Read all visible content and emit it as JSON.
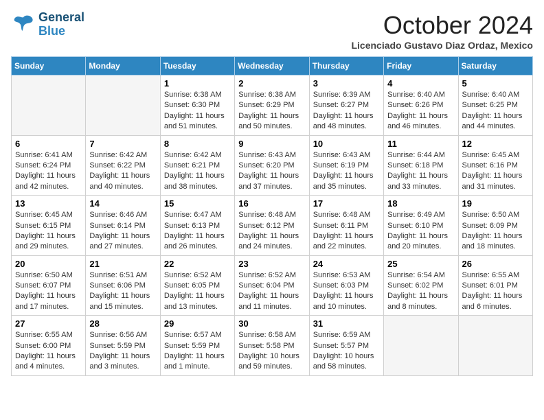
{
  "header": {
    "logo_line1": "General",
    "logo_line2": "Blue",
    "title": "October 2024",
    "location": "Licenciado Gustavo Diaz Ordaz, Mexico"
  },
  "weekdays": [
    "Sunday",
    "Monday",
    "Tuesday",
    "Wednesday",
    "Thursday",
    "Friday",
    "Saturday"
  ],
  "weeks": [
    [
      {
        "day": "",
        "empty": true
      },
      {
        "day": "",
        "empty": true
      },
      {
        "day": "1",
        "sunrise": "6:38 AM",
        "sunset": "6:30 PM",
        "daylight": "11 hours and 51 minutes."
      },
      {
        "day": "2",
        "sunrise": "6:38 AM",
        "sunset": "6:29 PM",
        "daylight": "11 hours and 50 minutes."
      },
      {
        "day": "3",
        "sunrise": "6:39 AM",
        "sunset": "6:27 PM",
        "daylight": "11 hours and 48 minutes."
      },
      {
        "day": "4",
        "sunrise": "6:40 AM",
        "sunset": "6:26 PM",
        "daylight": "11 hours and 46 minutes."
      },
      {
        "day": "5",
        "sunrise": "6:40 AM",
        "sunset": "6:25 PM",
        "daylight": "11 hours and 44 minutes."
      }
    ],
    [
      {
        "day": "6",
        "sunrise": "6:41 AM",
        "sunset": "6:24 PM",
        "daylight": "11 hours and 42 minutes."
      },
      {
        "day": "7",
        "sunrise": "6:42 AM",
        "sunset": "6:22 PM",
        "daylight": "11 hours and 40 minutes."
      },
      {
        "day": "8",
        "sunrise": "6:42 AM",
        "sunset": "6:21 PM",
        "daylight": "11 hours and 38 minutes."
      },
      {
        "day": "9",
        "sunrise": "6:43 AM",
        "sunset": "6:20 PM",
        "daylight": "11 hours and 37 minutes."
      },
      {
        "day": "10",
        "sunrise": "6:43 AM",
        "sunset": "6:19 PM",
        "daylight": "11 hours and 35 minutes."
      },
      {
        "day": "11",
        "sunrise": "6:44 AM",
        "sunset": "6:18 PM",
        "daylight": "11 hours and 33 minutes."
      },
      {
        "day": "12",
        "sunrise": "6:45 AM",
        "sunset": "6:16 PM",
        "daylight": "11 hours and 31 minutes."
      }
    ],
    [
      {
        "day": "13",
        "sunrise": "6:45 AM",
        "sunset": "6:15 PM",
        "daylight": "11 hours and 29 minutes."
      },
      {
        "day": "14",
        "sunrise": "6:46 AM",
        "sunset": "6:14 PM",
        "daylight": "11 hours and 27 minutes."
      },
      {
        "day": "15",
        "sunrise": "6:47 AM",
        "sunset": "6:13 PM",
        "daylight": "11 hours and 26 minutes."
      },
      {
        "day": "16",
        "sunrise": "6:48 AM",
        "sunset": "6:12 PM",
        "daylight": "11 hours and 24 minutes."
      },
      {
        "day": "17",
        "sunrise": "6:48 AM",
        "sunset": "6:11 PM",
        "daylight": "11 hours and 22 minutes."
      },
      {
        "day": "18",
        "sunrise": "6:49 AM",
        "sunset": "6:10 PM",
        "daylight": "11 hours and 20 minutes."
      },
      {
        "day": "19",
        "sunrise": "6:50 AM",
        "sunset": "6:09 PM",
        "daylight": "11 hours and 18 minutes."
      }
    ],
    [
      {
        "day": "20",
        "sunrise": "6:50 AM",
        "sunset": "6:07 PM",
        "daylight": "11 hours and 17 minutes."
      },
      {
        "day": "21",
        "sunrise": "6:51 AM",
        "sunset": "6:06 PM",
        "daylight": "11 hours and 15 minutes."
      },
      {
        "day": "22",
        "sunrise": "6:52 AM",
        "sunset": "6:05 PM",
        "daylight": "11 hours and 13 minutes."
      },
      {
        "day": "23",
        "sunrise": "6:52 AM",
        "sunset": "6:04 PM",
        "daylight": "11 hours and 11 minutes."
      },
      {
        "day": "24",
        "sunrise": "6:53 AM",
        "sunset": "6:03 PM",
        "daylight": "11 hours and 10 minutes."
      },
      {
        "day": "25",
        "sunrise": "6:54 AM",
        "sunset": "6:02 PM",
        "daylight": "11 hours and 8 minutes."
      },
      {
        "day": "26",
        "sunrise": "6:55 AM",
        "sunset": "6:01 PM",
        "daylight": "11 hours and 6 minutes."
      }
    ],
    [
      {
        "day": "27",
        "sunrise": "6:55 AM",
        "sunset": "6:00 PM",
        "daylight": "11 hours and 4 minutes."
      },
      {
        "day": "28",
        "sunrise": "6:56 AM",
        "sunset": "5:59 PM",
        "daylight": "11 hours and 3 minutes."
      },
      {
        "day": "29",
        "sunrise": "6:57 AM",
        "sunset": "5:59 PM",
        "daylight": "11 hours and 1 minute."
      },
      {
        "day": "30",
        "sunrise": "6:58 AM",
        "sunset": "5:58 PM",
        "daylight": "10 hours and 59 minutes."
      },
      {
        "day": "31",
        "sunrise": "6:59 AM",
        "sunset": "5:57 PM",
        "daylight": "10 hours and 58 minutes."
      },
      {
        "day": "",
        "empty": true
      },
      {
        "day": "",
        "empty": true
      }
    ]
  ]
}
